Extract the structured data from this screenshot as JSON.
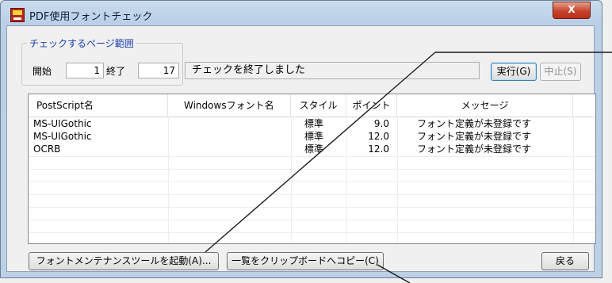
{
  "window": {
    "title": "PDF使用フォントチェック",
    "close_label": "X"
  },
  "range": {
    "legend": "チェックするページ範囲",
    "start_label": "開始",
    "start_value": "1",
    "end_label": "終了",
    "end_value": "17"
  },
  "status_text": "チェックを終了しました",
  "buttons": {
    "run": "実行(G)",
    "stop": "中止(S)",
    "launch_tool": "フォントメンテナンスツールを起動(A)...",
    "copy": "一覧をクリップボードへコピー(C)",
    "back": "戻る"
  },
  "table": {
    "columns": [
      "PostScript名",
      "Windowsフォント名",
      "スタイル",
      "ポイント",
      "メッセージ"
    ],
    "rows": [
      [
        "MS-UIGothic",
        "",
        "標準",
        "9.0",
        "フォント定義が未登録です"
      ],
      [
        "MS-UIGothic",
        "",
        "標準",
        "12.0",
        "フォント定義が未登録です"
      ],
      [
        "OCRB",
        "",
        "標準",
        "12.0",
        "フォント定義が未登録です"
      ]
    ]
  },
  "colors": {
    "legend": "#1b3fa8",
    "close_button": "#c7422a",
    "frame": "#bcd0e6"
  },
  "icons": {
    "app": "pdf-app-icon"
  }
}
